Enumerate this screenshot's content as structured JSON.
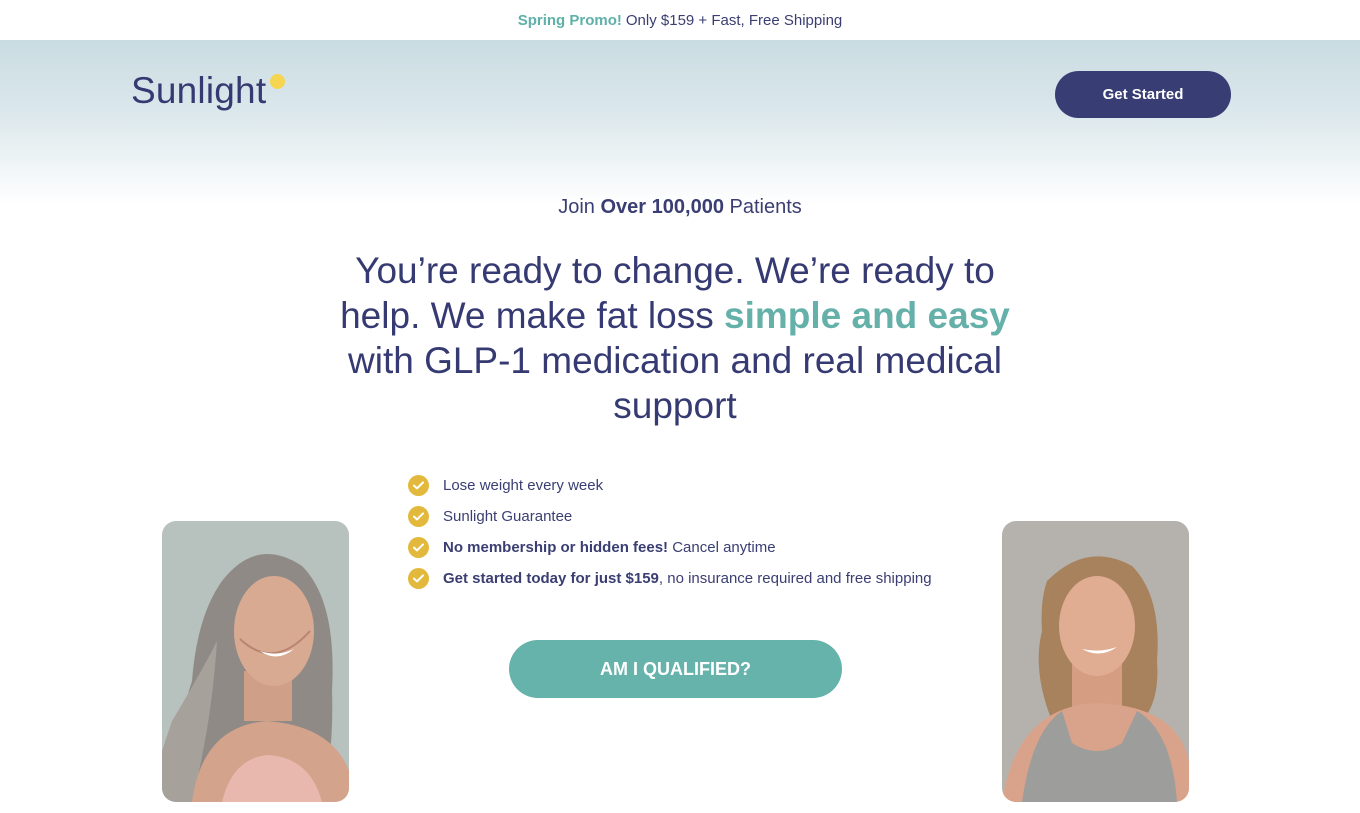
{
  "promo": {
    "highlight": "Spring Promo!",
    "text": "Only $159 + Fast, Free Shipping"
  },
  "header": {
    "logo_text": "Sunlight",
    "cta_label": "Get Started"
  },
  "hero": {
    "join_prefix": "Join",
    "join_bold": "Over 100,000",
    "join_suffix": "Patients",
    "headline_part1": "You’re ready to change. We’re ready to help. We make fat loss",
    "headline_accent": "simple and easy",
    "headline_part2": "with GLP-1 medication and real medical support"
  },
  "benefits": [
    {
      "bold": "",
      "text": "Lose weight every week"
    },
    {
      "bold": "",
      "text": "Sunlight Guarantee"
    },
    {
      "bold": "No membership or hidden fees!",
      "text": "Cancel anytime"
    },
    {
      "bold": "Get started today for just $159",
      "text": ", no insurance required and free shipping"
    }
  ],
  "cta": {
    "label": "AM I QUALIFIED?"
  },
  "colors": {
    "brand_navy": "#363a72",
    "accent_teal": "#65b1aa",
    "check_gold": "#e3b93d",
    "logo_sun": "#f6d551"
  },
  "icons": {
    "logo_mark": "sun-dot-icon",
    "benefit": "check-circle-icon"
  }
}
